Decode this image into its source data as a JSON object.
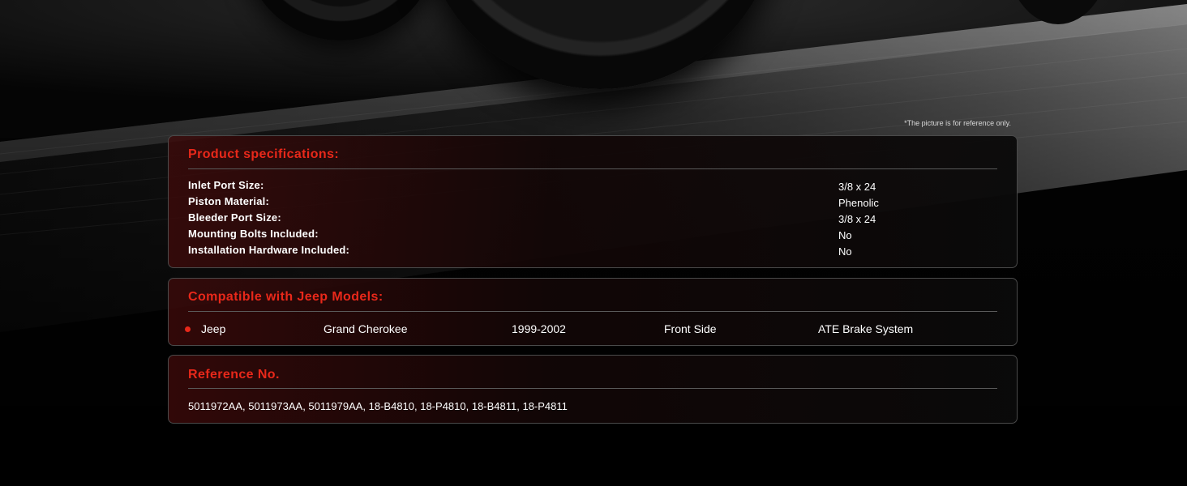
{
  "disclaimer": "*The picture is for reference only.",
  "specifications": {
    "title": "Product specifications:",
    "rows": [
      {
        "label": "Inlet Port Size:",
        "value": "3/8 x 24"
      },
      {
        "label": "Piston Material:",
        "value": "Phenolic"
      },
      {
        "label": "Bleeder Port Size:",
        "value": "3/8 x 24"
      },
      {
        "label": "Mounting Bolts Included:",
        "value": "No"
      },
      {
        "label": "Installation Hardware Included:",
        "value": "No"
      }
    ]
  },
  "compatibility": {
    "title": "Compatible with Jeep Models:",
    "row": {
      "make": "Jeep",
      "model": "Grand Cherokee",
      "years": "1999-2002",
      "position": "Front Side",
      "system": "ATE Brake System"
    }
  },
  "reference": {
    "title": "Reference No.",
    "numbers": "5011972AA, 5011973AA, 5011979AA, 18-B4810, 18-P4810, 18-B4811, 18-P4811"
  },
  "colors": {
    "accent": "#e8281a",
    "background": "#030303",
    "panel_border": "#4a4a4a"
  }
}
